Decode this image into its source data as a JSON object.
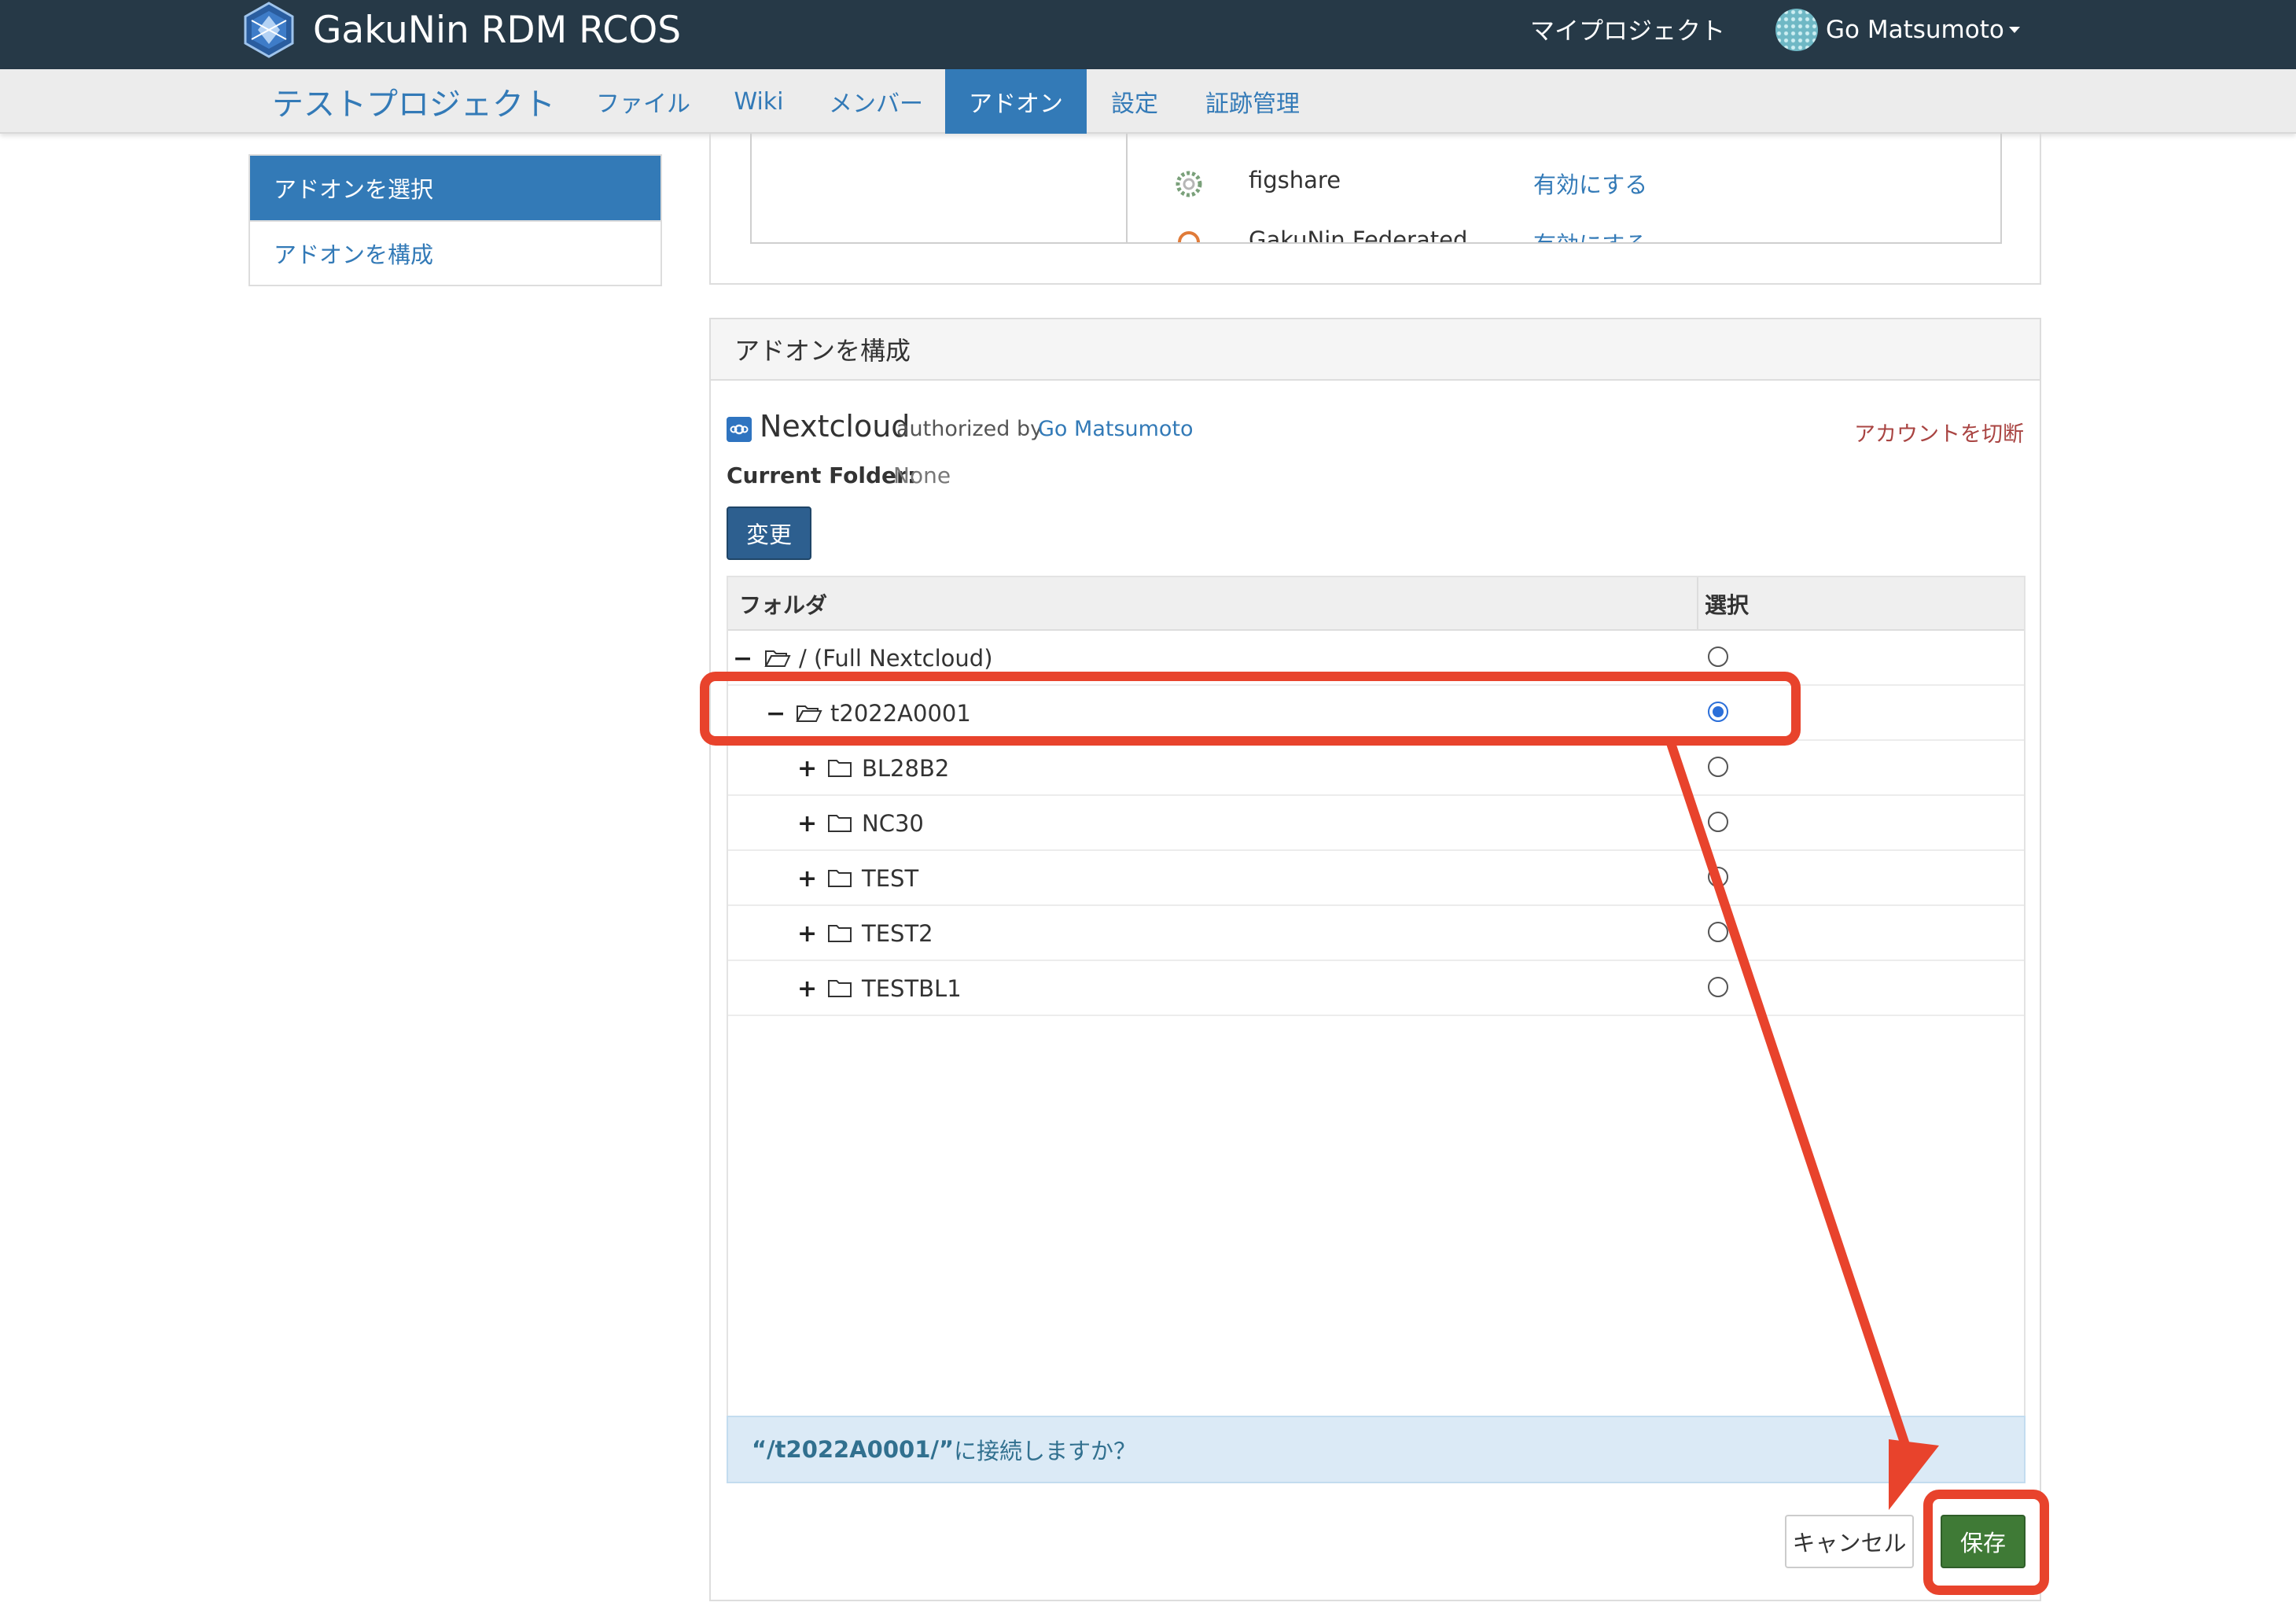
{
  "navbar": {
    "brand_name": "GakuNin RDM RCOS",
    "my_projects": "マイプロジェクト",
    "user_name": "Go Matsumoto"
  },
  "project_nav": {
    "title": "テストプロジェクト",
    "tabs": [
      {
        "label": "ファイル",
        "active": false
      },
      {
        "label": "Wiki",
        "active": false
      },
      {
        "label": "メンバー",
        "active": false
      },
      {
        "label": "アドオン",
        "active": true
      },
      {
        "label": "設定",
        "active": false
      },
      {
        "label": "証跡管理",
        "active": false
      }
    ]
  },
  "sidebar": {
    "items": [
      {
        "label": "アドオンを選択",
        "active": true
      },
      {
        "label": "アドオンを構成",
        "active": false
      }
    ]
  },
  "addon_list": {
    "items": [
      {
        "name": "figshare",
        "action": "有効にする"
      },
      {
        "name": "GakuNin Federated",
        "action": "有効にする"
      }
    ]
  },
  "config": {
    "panel_title": "アドオンを構成",
    "addon_name": "Nextcloud",
    "authorized_by": "authorized by",
    "user_name": "Go Matsumoto",
    "disconnect": "アカウントを切断",
    "current_folder_label": "Current Folder:",
    "current_folder_value": "None",
    "change_button": "変更",
    "table": {
      "col_folder": "フォルダ",
      "col_select": "選択",
      "rows": [
        {
          "toggle": "−",
          "name": "/ (Full Nextcloud)",
          "open": true,
          "selected": false
        },
        {
          "toggle": "−",
          "name": "t2022A0001",
          "open": true,
          "selected": true
        },
        {
          "toggle": "+",
          "name": "BL28B2",
          "open": false,
          "selected": false
        },
        {
          "toggle": "+",
          "name": "NC30",
          "open": false,
          "selected": false
        },
        {
          "toggle": "+",
          "name": "TEST",
          "open": false,
          "selected": false
        },
        {
          "toggle": "+",
          "name": "TEST2",
          "open": false,
          "selected": false
        },
        {
          "toggle": "+",
          "name": "TESTBL1",
          "open": false,
          "selected": false
        }
      ]
    },
    "confirm_path": "“/t2022A0001/”",
    "confirm_suffix": "に接続しますか？",
    "cancel_button": "キャンセル",
    "save_button": "保存"
  },
  "colors": {
    "navbar": "#263947",
    "primary": "#337ab7",
    "save": "#3f7a36",
    "annotation": "#e8432c"
  }
}
